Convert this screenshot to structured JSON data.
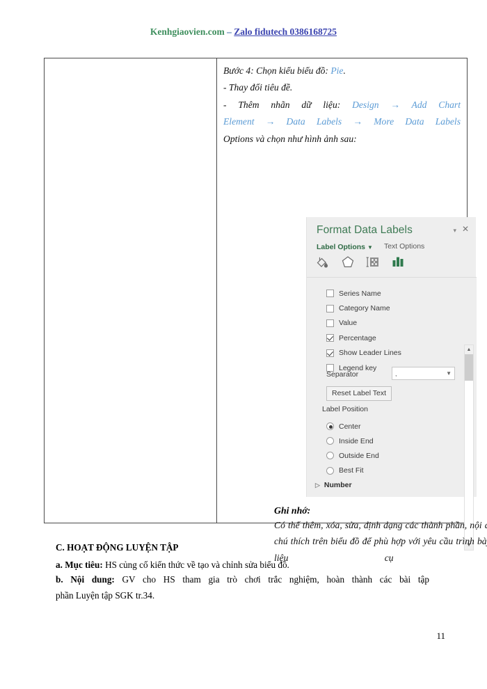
{
  "header": {
    "site": "Kenhgiaovien.com",
    "dash": " – ",
    "zalo": "Zalo fidutech 0386168725"
  },
  "table": {
    "right_cell": {
      "line1_prefix": "Bước 4: Chọn kiểu biểu đồ: ",
      "line1_blue": "Pie",
      "line1_suffix": ".",
      "line2": "- Thay đổi tiêu đề.",
      "line3_prefix": "- Thêm nhãn dữ liệu: ",
      "line3_blue": "Design → Add Chart",
      "line4_blue": "Element → Data Labels → More Data Labels",
      "line5": "Options và chọn như hình ảnh sau:",
      "note_title": "Ghi nhớ:",
      "note_body": "Có thể thêm, xóa, sửa, định dạng các thành phần, nội dung chú thích trên biểu đồ để phù hợp với yêu cầu trình bày dữ liệu cụ thể."
    }
  },
  "pane": {
    "title": "Format Data Labels",
    "dropdown_caret": "▾",
    "close": "✕",
    "tab_label_options": "Label Options",
    "tab_caret": "▼",
    "tab_text_options": "Text Options",
    "icons": [
      {
        "name": "fill-icon",
        "title": "Fill & Line"
      },
      {
        "name": "effects-icon",
        "title": "Effects"
      },
      {
        "name": "size-properties-icon",
        "title": "Size & Properties"
      },
      {
        "name": "label-options-icon",
        "title": "Label Options"
      }
    ],
    "label_contains": [
      {
        "label": "Series Name",
        "checked": false,
        "accel": "S"
      },
      {
        "label": "Category Name",
        "checked": false,
        "accel": "g"
      },
      {
        "label": "Value",
        "checked": false,
        "accel": "V"
      },
      {
        "label": "Percentage",
        "checked": true,
        "accel": "P"
      },
      {
        "label": "Show Leader Lines",
        "checked": true,
        "accel": "h"
      },
      {
        "label": "Legend key",
        "checked": false,
        "accel": "L"
      }
    ],
    "separator_label": "Separator",
    "separator_value": ",",
    "separator_caret": "▼",
    "reset_label": "Reset Label Text",
    "label_position_title": "Label Position",
    "label_positions": [
      {
        "label": "Center",
        "selected": true
      },
      {
        "label": "Inside End",
        "selected": false
      },
      {
        "label": "Outside End",
        "selected": false
      },
      {
        "label": "Best Fit",
        "selected": false
      }
    ],
    "number_section": "Number",
    "number_triangle": "▷",
    "scroll_up": "▲",
    "scroll_down": "▼"
  },
  "body": {
    "heading": "C. HOẠT ĐỘNG LUYỆN TẬP",
    "muc_tieu_label": "a. Mục tiêu:",
    "muc_tieu_text": " HS củng cố kiến thức về tạo và chỉnh sửa biểu đồ.",
    "noi_dung_label": "b. Nội dung:",
    "noi_dung_text": " GV cho HS tham gia trò chơi trắc nghiệm, hoàn thành các bài tập",
    "noi_dung_cont": "phần Luyện tập SGK tr.34.",
    "page_number": "11"
  },
  "colors": {
    "green": "#3e7a54",
    "blue_link": "#5b9bd5",
    "header_green": "#3f8f5e",
    "header_blue": "#3b44b0"
  }
}
